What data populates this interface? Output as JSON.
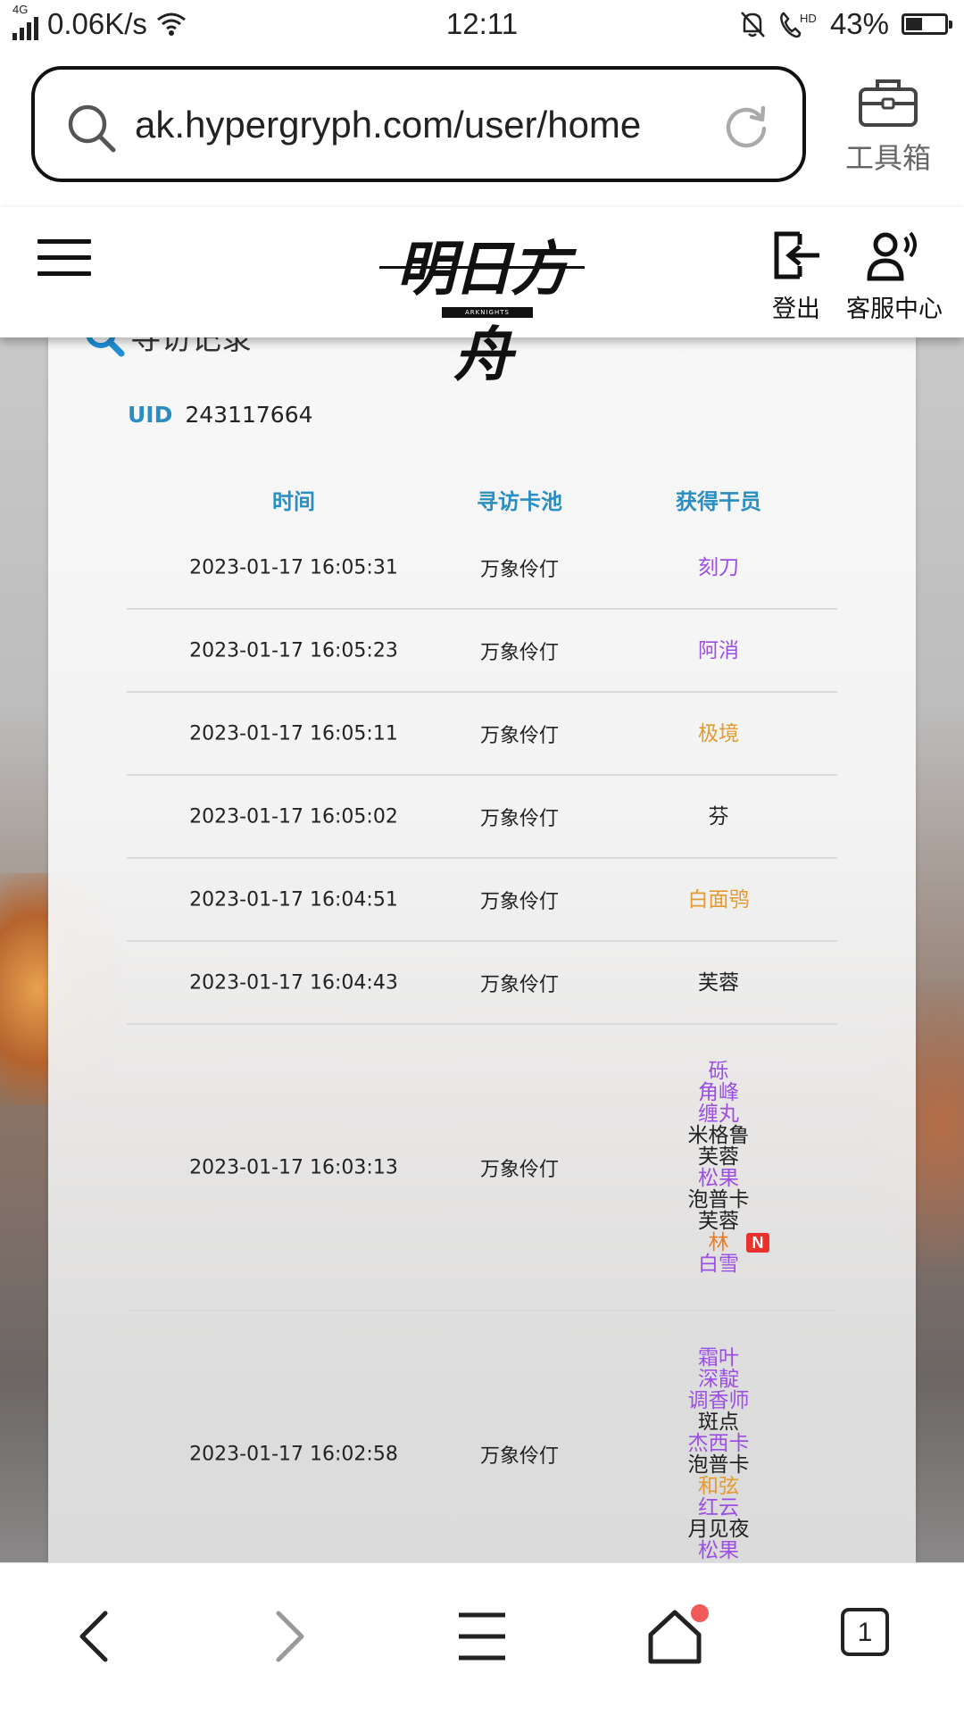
{
  "status_bar": {
    "network_type": "4G",
    "speed": "0.06K/s",
    "time": "12:11",
    "battery": "43%",
    "battery_level": 0.43,
    "icons": [
      "signal-icon",
      "wifi-icon",
      "mute-icon",
      "hd-call-icon",
      "battery-icon"
    ]
  },
  "browser": {
    "url": "ak.hypergryph.com/user/home",
    "toolbox_label": "工具箱"
  },
  "site_header": {
    "logo_text": "明日方舟",
    "logo_subtext": "ARKNIGHTS",
    "logout_label": "登出",
    "service_label": "客服中心"
  },
  "card": {
    "title": "寻访记录",
    "uid_label": "UID",
    "uid_value": "243117664"
  },
  "table": {
    "headers": [
      "时间",
      "寻访卡池",
      "获得干员"
    ],
    "rows": [
      {
        "time": "2023-01-17 16:05:31",
        "pool": "万象伶仃",
        "operators": [
          {
            "name": "刻刀",
            "rarity": 4
          }
        ]
      },
      {
        "time": "2023-01-17 16:05:23",
        "pool": "万象伶仃",
        "operators": [
          {
            "name": "阿消",
            "rarity": 4
          }
        ]
      },
      {
        "time": "2023-01-17 16:05:11",
        "pool": "万象伶仃",
        "operators": [
          {
            "name": "极境",
            "rarity": 5
          }
        ]
      },
      {
        "time": "2023-01-17 16:05:02",
        "pool": "万象伶仃",
        "operators": [
          {
            "name": "芬",
            "rarity": 3
          }
        ]
      },
      {
        "time": "2023-01-17 16:04:51",
        "pool": "万象伶仃",
        "operators": [
          {
            "name": "白面鸮",
            "rarity": 5
          }
        ]
      },
      {
        "time": "2023-01-17 16:04:43",
        "pool": "万象伶仃",
        "operators": [
          {
            "name": "芙蓉",
            "rarity": 3
          }
        ]
      },
      {
        "time": "2023-01-17 16:03:13",
        "pool": "万象伶仃",
        "operators": [
          {
            "name": "砾",
            "rarity": 4
          },
          {
            "name": "角峰",
            "rarity": 4
          },
          {
            "name": "缠丸",
            "rarity": 4
          },
          {
            "name": "米格鲁",
            "rarity": 3
          },
          {
            "name": "芙蓉",
            "rarity": 3
          },
          {
            "name": "松果",
            "rarity": 4
          },
          {
            "name": "泡普卡",
            "rarity": 3
          },
          {
            "name": "芙蓉",
            "rarity": 3
          },
          {
            "name": "林",
            "rarity": 6,
            "badge": "N"
          },
          {
            "name": "白雪",
            "rarity": 4
          }
        ]
      },
      {
        "time": "2023-01-17 16:02:58",
        "pool": "万象伶仃",
        "operators": [
          {
            "name": "霜叶",
            "rarity": 4
          },
          {
            "name": "深靛",
            "rarity": 4
          },
          {
            "name": "调香师",
            "rarity": 4
          },
          {
            "name": "斑点",
            "rarity": 3
          },
          {
            "name": "杰西卡",
            "rarity": 4
          },
          {
            "name": "泡普卡",
            "rarity": 3
          },
          {
            "name": "和弦",
            "rarity": 5
          },
          {
            "name": "红云",
            "rarity": 4
          },
          {
            "name": "月见夜",
            "rarity": 3
          },
          {
            "name": "松果",
            "rarity": 4
          }
        ]
      }
    ]
  },
  "rarity_colors": {
    "3": "#222222",
    "4": "#9b4fe3",
    "5": "#e39a2e",
    "6": "#ea7d24"
  },
  "bottom_nav": {
    "items": [
      "back-icon",
      "forward-icon",
      "menu-icon",
      "home-icon",
      "tabs-icon"
    ],
    "tab_count": "1"
  }
}
